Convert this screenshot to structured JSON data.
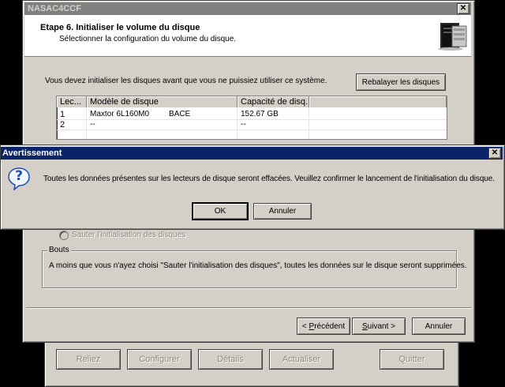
{
  "background_window": {
    "buttons": [
      {
        "label": "Reliez"
      },
      {
        "label": "Configurer"
      },
      {
        "label": "Détails"
      },
      {
        "label": "Actualiser"
      },
      {
        "label": "Quitter"
      }
    ]
  },
  "wizard": {
    "title": "NASAC4CCF",
    "close_glyph": "✕",
    "step_title": "Etape 6. Initialiser le volume du disque",
    "step_subtitle": "Sélectionner la configuration du volume du disque.",
    "intro_text": "Vous devez initialiser les disques avant que vous ne puissiez utiliser ce système.",
    "rescan_label": "Rebalayer les disques",
    "table": {
      "headers": [
        "Lec...",
        "Modèle de disque",
        "Capacité de disq...",
        ""
      ],
      "rows": [
        {
          "index": "1",
          "model": "Maxtor  6L160M0",
          "rev": "BACE",
          "capacity": "152.67 GB"
        },
        {
          "index": "2",
          "model": "--",
          "rev": "",
          "capacity": "--"
        }
      ]
    },
    "skip_option": "Sauter l'initialisation des disques",
    "tips_title": "Bouts",
    "tips_text": "A moins que vous n'ayez choisi \"Sauter l'initialisation des disques\", toutes les données sur le disque seront supprimées.",
    "back_prefix": "< ",
    "back_hotkey": "P",
    "back_rest": "récédent",
    "next_hotkey": "S",
    "next_rest": "uivant >",
    "cancel_label": "Annuler"
  },
  "dialog": {
    "title": "Avertissement",
    "close_glyph": "✕",
    "icon_glyph": "?",
    "message": "Toutes les données présentes sur les lecteurs de disque seront effacées. Veuillez confirmer le lancement de l'initialisation du disque.",
    "ok_label": "OK",
    "cancel_label": "Annuler"
  }
}
